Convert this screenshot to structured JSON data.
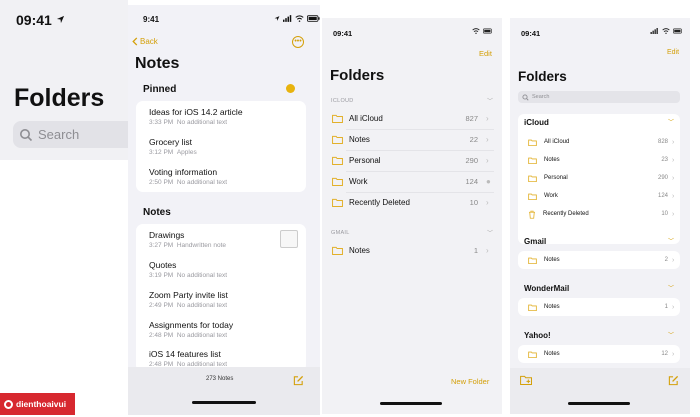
{
  "colors": {
    "accent": "#d4a00a",
    "folder": "#e2b02a",
    "logo": "#d7282f"
  },
  "panel1": {
    "time": "09:41",
    "title": "Folders",
    "search_placeholder": "Search"
  },
  "panel2": {
    "time": "9:41",
    "back": "Back",
    "title": "Notes",
    "pinned_header": "Pinned",
    "pinned": [
      {
        "title": "Ideas for iOS 14.2 article",
        "time": "3:33 PM",
        "sub": "No additional text"
      },
      {
        "title": "Grocery list",
        "time": "3:12 PM",
        "sub": "Apples"
      },
      {
        "title": "Voting information",
        "time": "2:50 PM",
        "sub": "No additional text"
      }
    ],
    "notes_header": "Notes",
    "notes": [
      {
        "title": "Drawings",
        "time": "3:27 PM",
        "sub": "Handwritten note"
      },
      {
        "title": "Quotes",
        "time": "3:19 PM",
        "sub": "No additional text"
      },
      {
        "title": "Zoom Party invite list",
        "time": "2:49 PM",
        "sub": "No additional text"
      },
      {
        "title": "Assignments for today",
        "time": "2:48 PM",
        "sub": "No additional text"
      },
      {
        "title": "iOS 14 features list",
        "time": "2:48 PM",
        "sub": "No additional text"
      }
    ],
    "count": "273 Notes"
  },
  "panel3": {
    "time": "09:41",
    "edit": "Edit",
    "title": "Folders",
    "icloud_header": "ICLOUD",
    "icloud": [
      {
        "name": "All iCloud",
        "count": "827"
      },
      {
        "name": "Notes",
        "count": "22"
      },
      {
        "name": "Personal",
        "count": "290"
      },
      {
        "name": "Work",
        "count": "124"
      },
      {
        "name": "Recently Deleted",
        "count": "10"
      }
    ],
    "gmail_header": "GMAIL",
    "gmail": [
      {
        "name": "Notes",
        "count": "1"
      }
    ],
    "new_folder": "New Folder"
  },
  "panel4": {
    "time": "09:41",
    "edit": "Edit",
    "title": "Folders",
    "search_placeholder": "Search",
    "groups": [
      {
        "name": "iCloud",
        "items": [
          {
            "name": "All iCloud",
            "count": "828"
          },
          {
            "name": "Notes",
            "count": "23"
          },
          {
            "name": "Personal",
            "count": "290"
          },
          {
            "name": "Work",
            "count": "124"
          },
          {
            "name": "Recently Deleted",
            "count": "10"
          }
        ]
      },
      {
        "name": "Gmail",
        "items": [
          {
            "name": "Notes",
            "count": "2"
          }
        ]
      },
      {
        "name": "WonderMail",
        "items": [
          {
            "name": "Notes",
            "count": "1"
          }
        ]
      },
      {
        "name": "Yahoo!",
        "items": [
          {
            "name": "Notes",
            "count": "12"
          }
        ]
      }
    ]
  },
  "logo": {
    "text": "dienthoaivui"
  }
}
